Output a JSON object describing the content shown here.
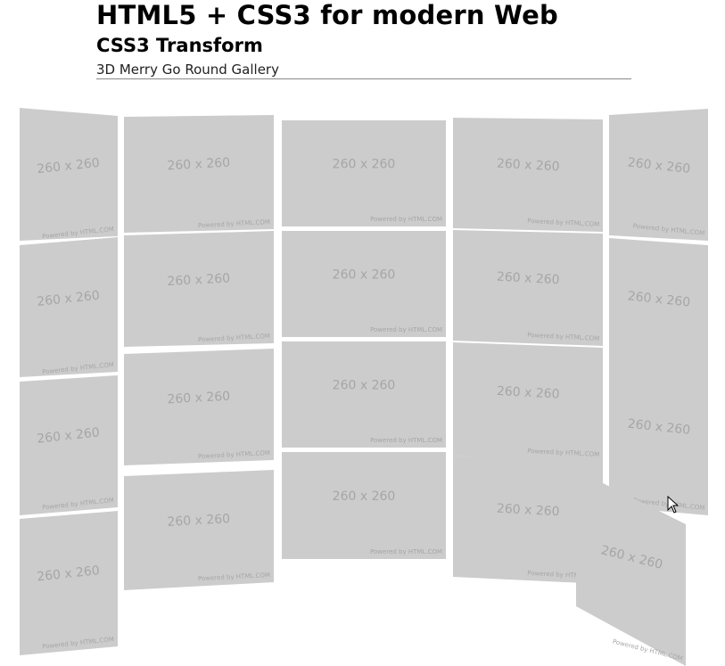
{
  "header": {
    "title": "HTML5 + CSS3 for modern Web",
    "subtitle": "CSS3 Transform",
    "caption": "3D Merry Go Round Gallery"
  },
  "gallery": {
    "placeholder_label": "260 x 260",
    "placeholder_footer": "Powered by HTML.COM",
    "tile_color": "#cccccc",
    "text_color": "#a6a6a6",
    "rows": 4,
    "columns": 5
  },
  "cursor": {
    "icon": "arrow-cursor-icon"
  }
}
